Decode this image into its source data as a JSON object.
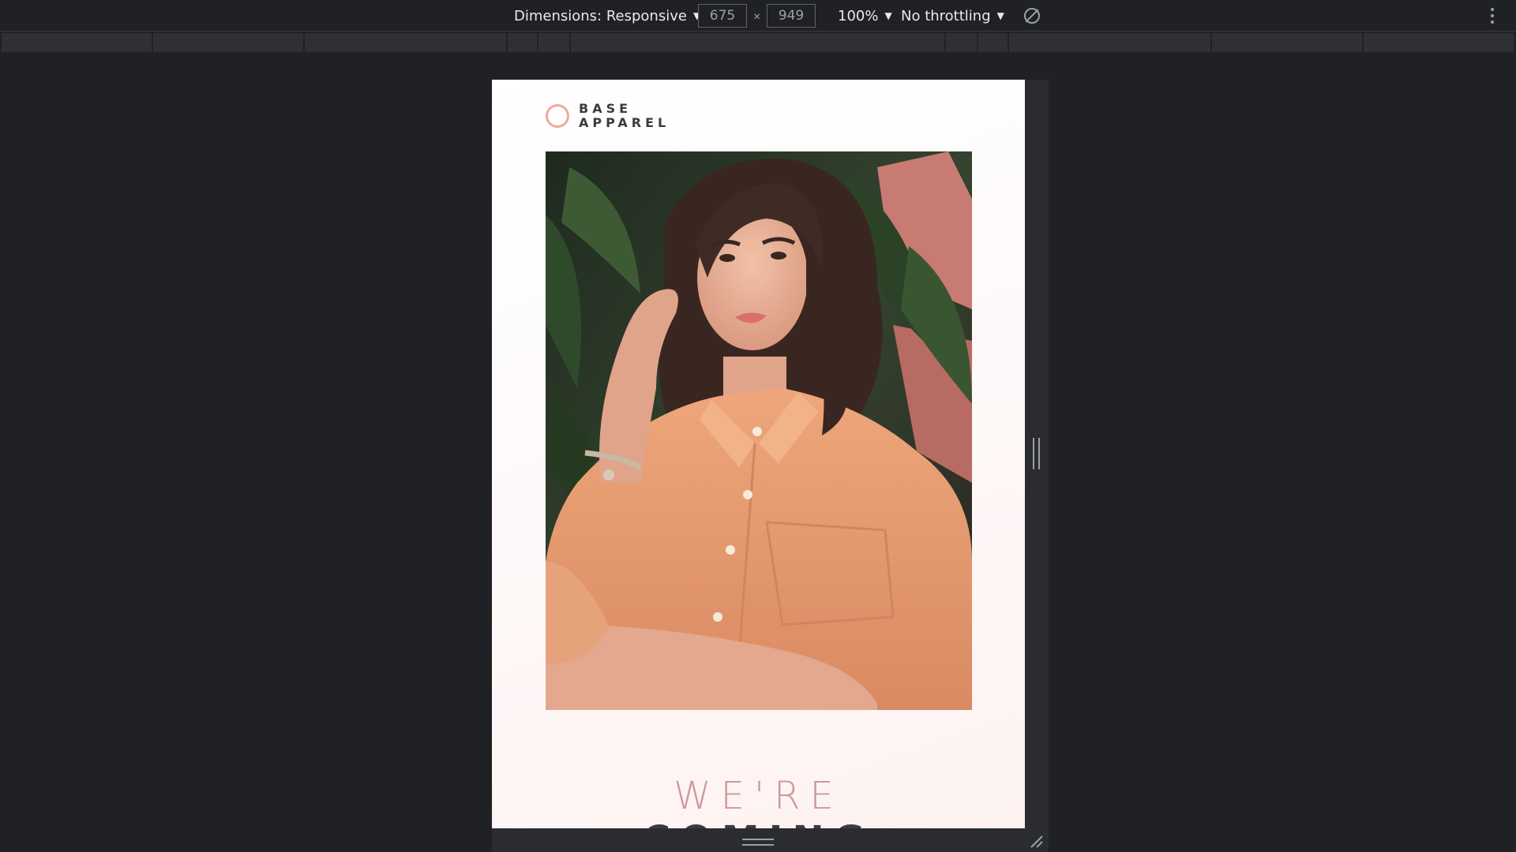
{
  "devtools": {
    "dimensions_label": "Dimensions: Responsive",
    "width_value": "675",
    "times_symbol": "×",
    "height_value": "949",
    "zoom_label": "100%",
    "throttling_label": "No throttling",
    "caret": "▼"
  },
  "page": {
    "logo": {
      "line1": "BASE",
      "line2": "APPAREL"
    },
    "headline": {
      "line1": "WE'RE",
      "line2": "COMING"
    }
  },
  "colors": {
    "accent": "#ce9797",
    "logo_ring": "#f0a7a0",
    "text_dark": "#3d3a3a"
  }
}
